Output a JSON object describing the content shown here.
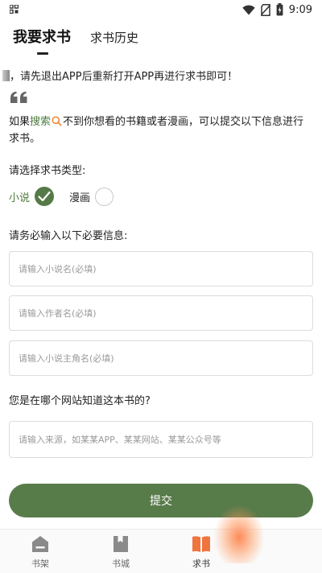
{
  "status_bar": {
    "time": "9:09"
  },
  "tabs": {
    "active": "我要求书",
    "inactive": "求书历史"
  },
  "notice": "，请先退出APP后重新打开APP再进行求书即可！",
  "intro": {
    "before": "如果",
    "highlight": "搜索",
    "after": "不到你想看的书籍或者漫画，可以提交以下信息进行求书。"
  },
  "book_type": {
    "label": "请选择求书类型:",
    "options": [
      {
        "label": "小说",
        "checked": true
      },
      {
        "label": "漫画",
        "checked": false
      }
    ]
  },
  "required_label": "请务必输入以下必要信息:",
  "fields": [
    {
      "placeholder": "请输入小说名(必填)"
    },
    {
      "placeholder": "请输入作者名(必填)"
    },
    {
      "placeholder": "请输入小说主角名(必填)"
    }
  ],
  "source": {
    "label": "您是在哪个网站知道这本书的?",
    "placeholder": "请输入来源，如某某APP、某某网站、某某公众号等"
  },
  "submit_label": "提交",
  "bottom_nav": [
    {
      "label": "书架",
      "icon": "bookshelf-icon"
    },
    {
      "label": "书城",
      "icon": "bookstore-icon"
    },
    {
      "label": "求书",
      "icon": "request-book-icon",
      "active": true
    }
  ],
  "colors": {
    "accent": "#587b4a",
    "highlight_text": "#4d7a3e",
    "nav_active": "#f0743e"
  }
}
